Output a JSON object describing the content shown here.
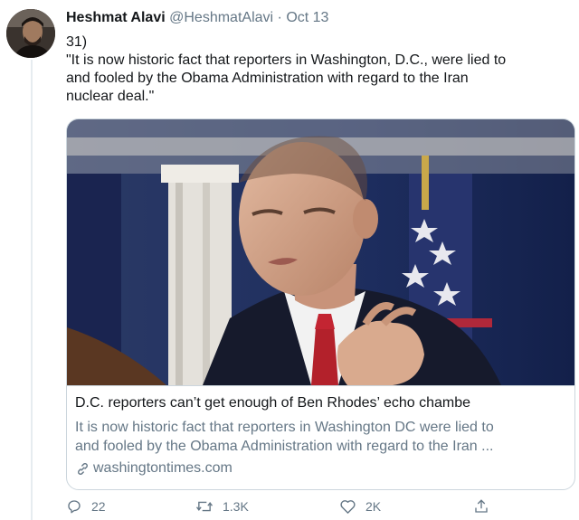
{
  "tweet": {
    "display_name": "Heshmat Alavi",
    "handle": "@HeshmatAlavi",
    "separator": "·",
    "date": "Oct 13",
    "text_lines": [
      "31)",
      "\"It is now historic fact that reporters in Washington, D.C., were lied to",
      "and fooled by the Obama Administration with regard to the Iran",
      "nuclear deal.\""
    ]
  },
  "card": {
    "title": "D.C. reporters can’t get enough of Ben Rhodes’ echo chambe",
    "description_lines": [
      "It is now historic fact that reporters in Washington DC were lied to",
      "and fooled by the Obama Administration with regard to the Iran ..."
    ],
    "domain": "washingtontimes.com"
  },
  "actions": {
    "replies": "22",
    "retweets": "1.3K",
    "likes": "2K"
  },
  "colors": {
    "text": "#14171a",
    "secondary": "#657786",
    "border": "#ccd6dd"
  }
}
